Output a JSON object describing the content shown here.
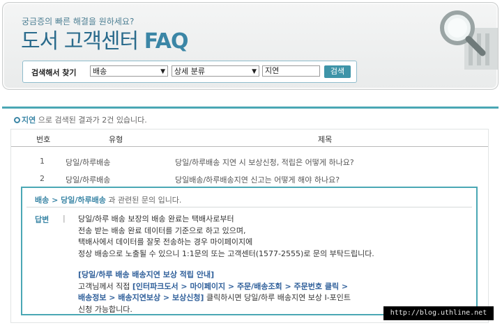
{
  "header": {
    "subtitle": "궁금증의 빠른 해결을 원하세요?",
    "title_main": "도서 고객센터",
    "title_faq": "FAQ"
  },
  "search": {
    "label": "검색해서 찾기",
    "category": "배송",
    "subcategory": "상세 분류",
    "keyword": "지연",
    "button": "검색"
  },
  "results": {
    "keyword": "지연",
    "summary": "으로 검색된 결과가 2건 있습니다.",
    "columns": [
      "번호",
      "유형",
      "제목"
    ],
    "rows": [
      {
        "no": "1",
        "type": "당일/하루배송",
        "title": "당일/하루배송 지연 시 보상신청, 적립은 어떻게 하나요?"
      },
      {
        "no": "2",
        "type": "당일/하루배송",
        "title": "당일배송/하루배송지연 신고는 어떻게 해야 하나요?"
      }
    ]
  },
  "detail": {
    "breadcrumb": "배송 > 당일/하루배송",
    "breadcrumb_suffix": "과 관련된 문의 입니다.",
    "answer_label": "답변",
    "answer_sep": "|",
    "answer_lines": [
      "당일/하루 배송 보장의 배송 완료는 택배사로부터",
      "전송 받는 배송 완료 데이터를 기준으로 하고 있으며,",
      "택배사에서 데이터를 잘못 전송하는 경우 마이페이지에",
      "정상 배송으로 노출될 수 있으니 1:1문의 또는 고객센터(1577-2555)로 문의 부탁드립니다."
    ],
    "guide_title": "[당일/하루 배송 배송지연 보상 적립 안내]",
    "guide_prefix": "고객님께서 직접",
    "guide_path1": "[인터파크도서 > 마이페이지 > 주문/배송조회 > 주문번호 클릭 >",
    "guide_path2": "배송정보 > 배송지연보상 > 보상신청]",
    "guide_suffix": "클릭하시면 당일/하루 배송지연 보상 I-포인트",
    "guide_end": "신청 가능합니다."
  },
  "watermark": "http://blog.uthline.net"
}
